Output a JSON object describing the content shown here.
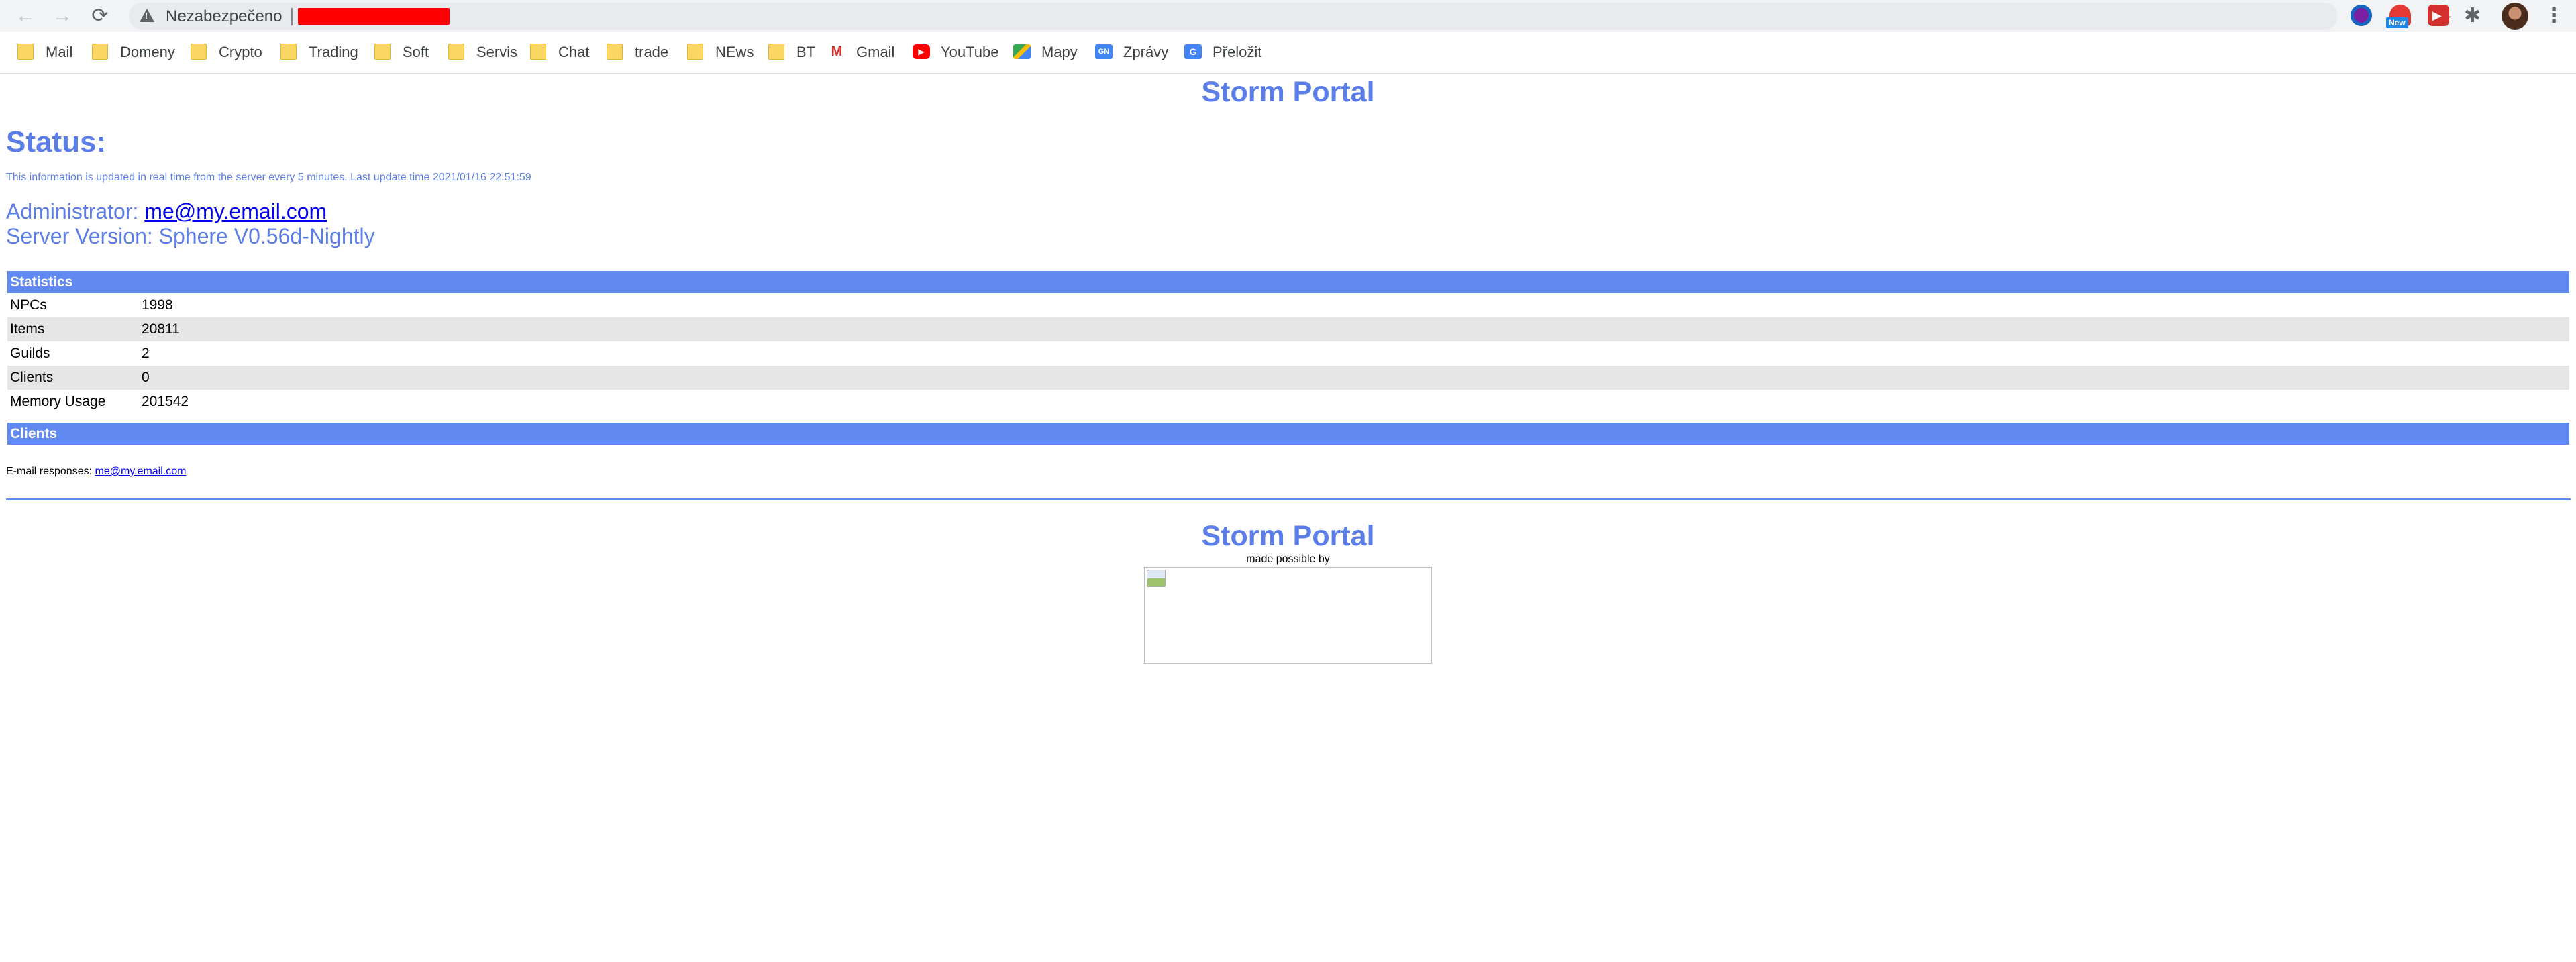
{
  "browser": {
    "nav": {
      "back": "←",
      "forward": "→",
      "reload": "⟳"
    },
    "omnibox": {
      "security_label": "Nezabezpečeno"
    },
    "icons": {
      "star": "☆",
      "puzzle": "✱",
      "menu": "⋮",
      "ext_badge": "New"
    },
    "bookmarks": [
      {
        "label": "Mail",
        "icon": "folder-icon"
      },
      {
        "label": "Domeny",
        "icon": "folder-icon"
      },
      {
        "label": "Crypto",
        "icon": "folder-icon"
      },
      {
        "label": "Trading",
        "icon": "folder-icon"
      },
      {
        "label": "Soft",
        "icon": "folder-icon"
      },
      {
        "label": "Servis",
        "icon": "folder-icon"
      },
      {
        "label": "Chat",
        "icon": "folder-icon"
      },
      {
        "label": "trade",
        "icon": "folder-icon"
      },
      {
        "label": "NEws",
        "icon": "folder-icon"
      },
      {
        "label": "BT",
        "icon": "folder-icon"
      },
      {
        "label": "Gmail",
        "icon": "gmail-icon"
      },
      {
        "label": "YouTube",
        "icon": "youtube-icon"
      },
      {
        "label": "Mapy",
        "icon": "maps-icon"
      },
      {
        "label": "Zprávy",
        "icon": "news-icon"
      },
      {
        "label": "Přeložit",
        "icon": "translate-icon"
      }
    ]
  },
  "page": {
    "title": "Storm Portal",
    "status_heading": "Status:",
    "update_info": "This information is updated in real time from the server every 5 minutes. Last update time 2021/01/16 22:51:59",
    "admin_label": "Administrator:",
    "admin_email": "me@my.email.com",
    "server_version": "Server Version: Sphere V0.56d-Nightly",
    "statistics": {
      "header": "Statistics",
      "rows": [
        {
          "label": "NPCs",
          "value": "1998"
        },
        {
          "label": "Items",
          "value": "20811"
        },
        {
          "label": "Guilds",
          "value": "2"
        },
        {
          "label": "Clients",
          "value": "0"
        },
        {
          "label": "Memory Usage",
          "value": "201542"
        }
      ]
    },
    "clients_header": "Clients",
    "email_responses_label": "E-mail responses:",
    "email_responses_link": "me@my.email.com",
    "footer": {
      "title": "Storm Portal",
      "made_by": "made possible by"
    }
  }
}
